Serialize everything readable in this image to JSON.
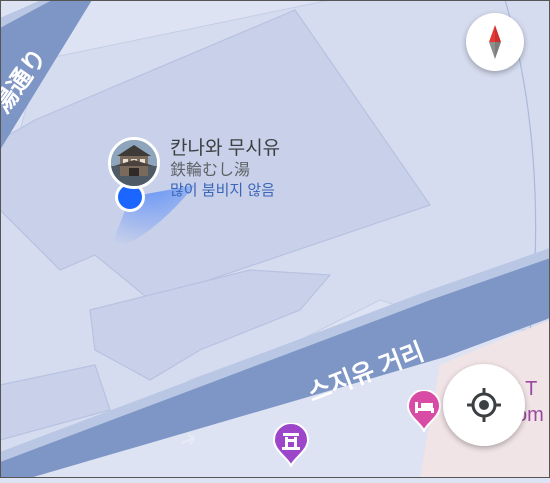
{
  "map": {
    "road_upper_label": "湯通り",
    "road_main_label": "스지유 거리",
    "place": {
      "name": "칸나와 무시유",
      "subtitle": "鉄輪むし湯",
      "status": "많이 붐비지 않음",
      "photo_icon": "bathhouse-photo"
    },
    "edge_poi_text_1": "P T",
    "edge_poi_text_2": "om",
    "pois": [
      {
        "icon": "hotel-bed-icon",
        "color": "#d94ca6"
      },
      {
        "icon": "shrine-gate-icon",
        "color": "#9d46c9"
      }
    ]
  },
  "controls": {
    "compass_icon": "compass-icon",
    "locate_icon": "my-location-icon"
  },
  "colors": {
    "background": "#dde3f3",
    "building": "#ccd4ea",
    "road": "#7e96c5",
    "road_label": "#ffffff",
    "user_location": "#1a66ff",
    "compass_red": "#e53935"
  }
}
